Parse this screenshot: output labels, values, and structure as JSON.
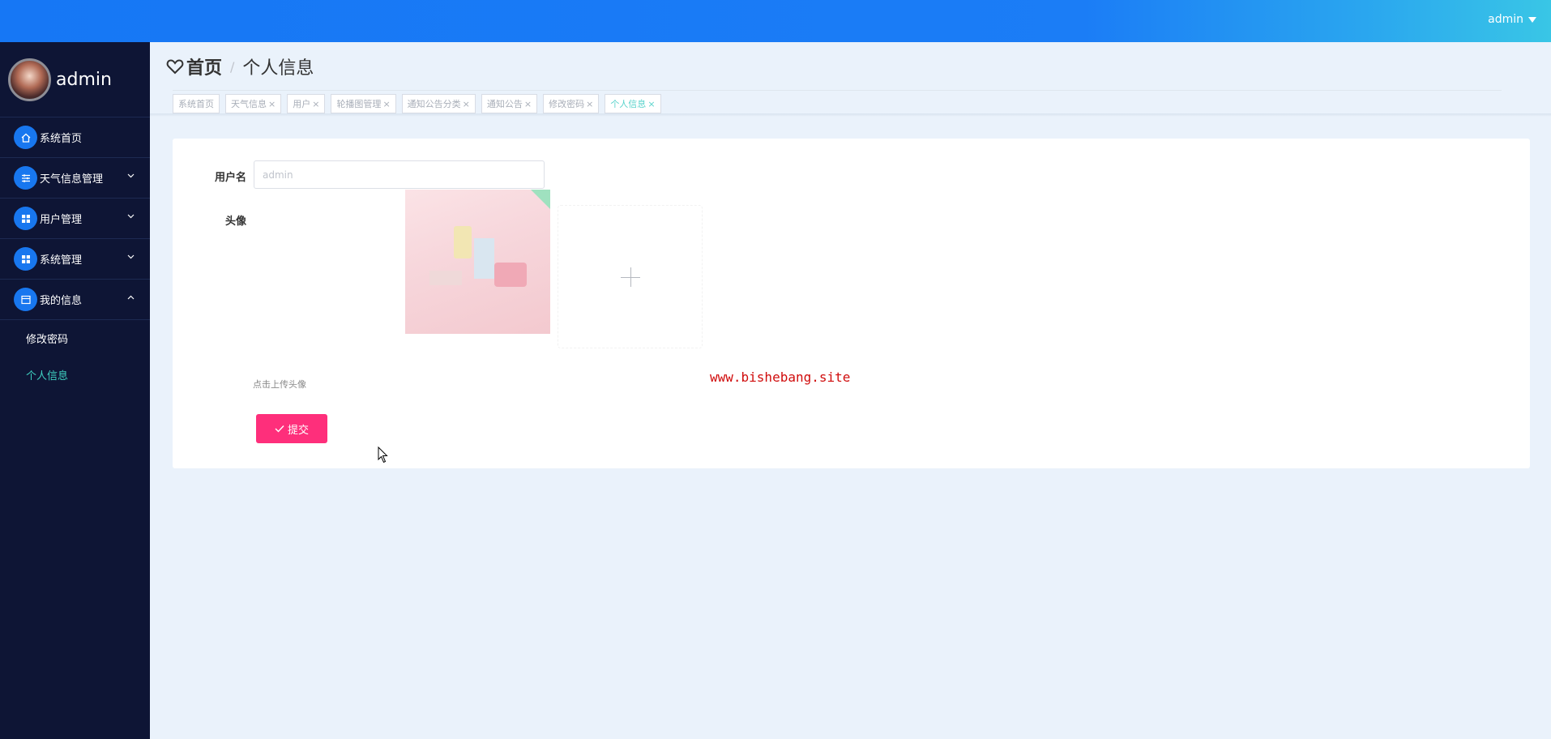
{
  "topbar": {
    "user": "admin",
    "caret_icon": "caret-down-icon"
  },
  "sidebar": {
    "profile_name": "admin",
    "items": [
      {
        "label": "系统首页",
        "icon": "home-icon",
        "expandable": false
      },
      {
        "label": "天气信息管理",
        "icon": "sliders-icon",
        "expandable": true,
        "expanded": false
      },
      {
        "label": "用户管理",
        "icon": "grid-icon",
        "expandable": true,
        "expanded": false
      },
      {
        "label": "系统管理",
        "icon": "grid-icon",
        "expandable": true,
        "expanded": false
      },
      {
        "label": "我的信息",
        "icon": "panel-icon",
        "expandable": true,
        "expanded": true
      }
    ],
    "subitems": [
      {
        "label": "修改密码",
        "active": false
      },
      {
        "label": "个人信息",
        "active": true
      }
    ],
    "active_color": "#3fd0c0"
  },
  "breadcrumb": {
    "home": "首页",
    "separator": "/",
    "current": "个人信息",
    "icon": "heart-icon"
  },
  "tabs": [
    {
      "label": "系统首页",
      "closable": false,
      "active": false
    },
    {
      "label": "天气信息",
      "closable": true,
      "active": false
    },
    {
      "label": "用户",
      "closable": true,
      "active": false
    },
    {
      "label": "轮播图管理",
      "closable": true,
      "active": false
    },
    {
      "label": "通知公告分类",
      "closable": true,
      "active": false
    },
    {
      "label": "通知公告",
      "closable": true,
      "active": false
    },
    {
      "label": "修改密码",
      "closable": true,
      "active": false
    },
    {
      "label": "个人信息",
      "closable": true,
      "active": true
    }
  ],
  "form": {
    "username_label": "用户名",
    "username_value": "admin",
    "avatar_label": "头像",
    "upload_hint": "点击上传头像",
    "submit_label": "提交"
  },
  "watermark": "www.bishebang.site",
  "colors": {
    "primary": "#1877ef",
    "submit": "#fe2f7b",
    "sidebar_bg": "#0e1535"
  }
}
